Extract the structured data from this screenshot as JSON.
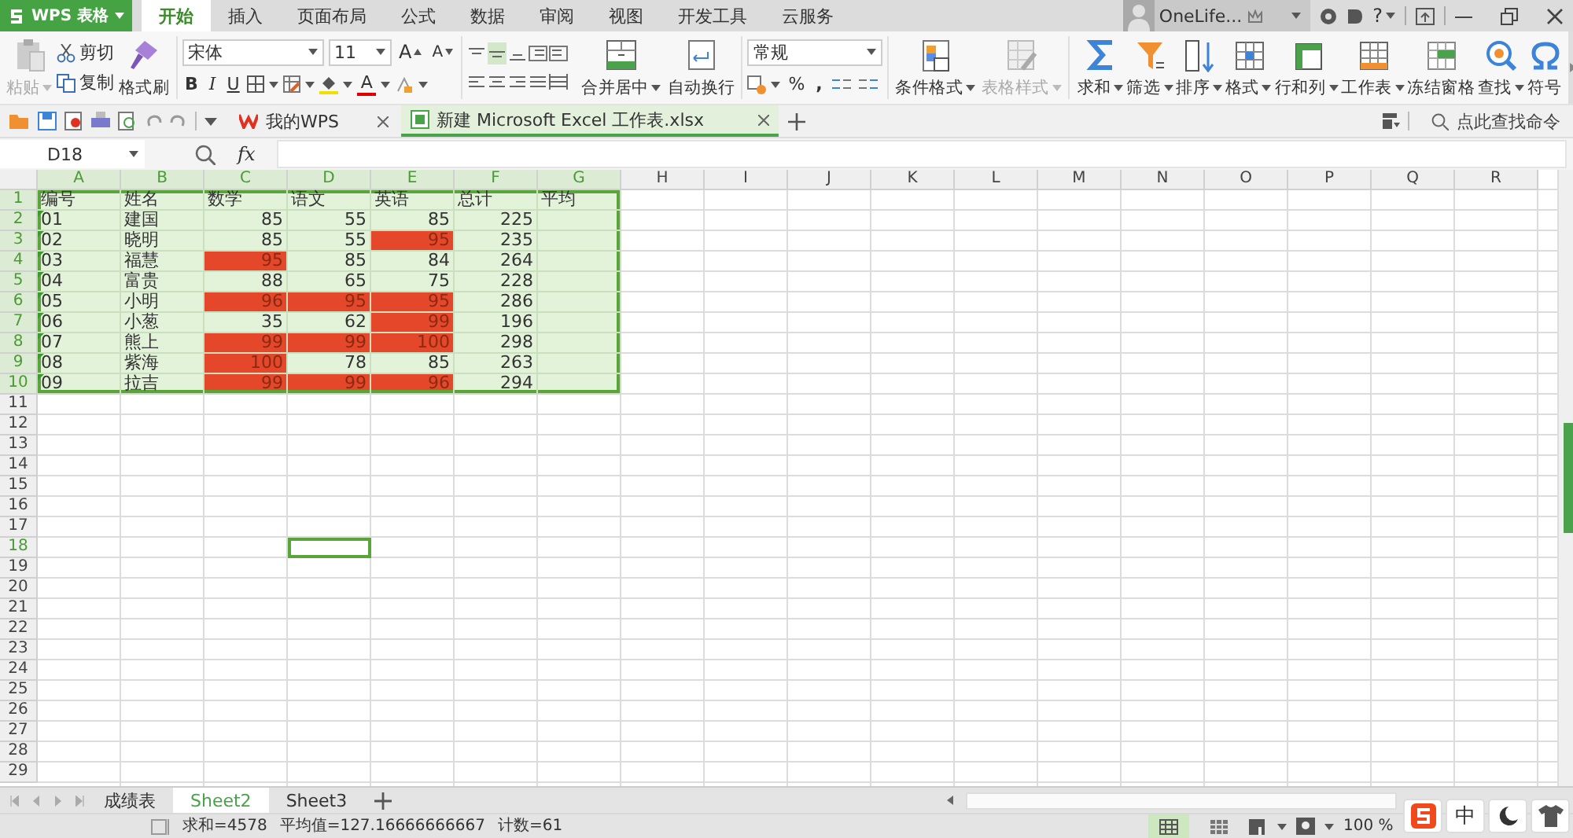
{
  "app_menu": {
    "label": "WPS 表格"
  },
  "ribbon_tabs": [
    {
      "label": "开始",
      "selected": true
    },
    {
      "label": "插入",
      "selected": false
    },
    {
      "label": "页面布局",
      "selected": false
    },
    {
      "label": "公式",
      "selected": false
    },
    {
      "label": "数据",
      "selected": false
    },
    {
      "label": "审阅",
      "selected": false
    },
    {
      "label": "视图",
      "selected": false
    },
    {
      "label": "开发工具",
      "selected": false
    },
    {
      "label": "云服务",
      "selected": false
    }
  ],
  "account": {
    "name": "OneLife...",
    "help": "?"
  },
  "ribbon": {
    "paste": {
      "label": "粘贴",
      "disabled": true
    },
    "cut": "剪切",
    "copy": "复制",
    "format_painter": "格式刷",
    "font_name": "宋体",
    "font_size": "11",
    "grow_font": "A",
    "shrink_font": "A",
    "bold": "B",
    "italic": "I",
    "underline": "U",
    "font_color": "A",
    "align_buttons": [
      {
        "label": "合并居中",
        "caret": true
      },
      {
        "label": "自动换行",
        "caret": false
      }
    ],
    "number_format": "常规",
    "percent": "%",
    "comma": ",",
    "tools": [
      {
        "label": "条件格式",
        "caret": true,
        "disabled": false
      },
      {
        "label": "表格样式",
        "caret": true,
        "disabled": true
      },
      {
        "label": "求和",
        "caret": true,
        "disabled": false
      },
      {
        "label": "筛选",
        "caret": true,
        "disabled": false
      },
      {
        "label": "排序",
        "caret": true,
        "disabled": false
      },
      {
        "label": "格式",
        "caret": true,
        "disabled": false
      },
      {
        "label": "行和列",
        "caret": true,
        "disabled": false
      },
      {
        "label": "工作表",
        "caret": true,
        "disabled": false
      },
      {
        "label": "冻结窗格",
        "caret": false,
        "disabled": false
      },
      {
        "label": "查找",
        "caret": true,
        "disabled": false
      },
      {
        "label": "符号",
        "caret": false,
        "disabled": false
      }
    ],
    "command_search": {
      "placeholder": "点此查找命令"
    }
  },
  "doc_tabs": [
    {
      "label": "我的WPS",
      "selected": false
    },
    {
      "label": "新建 Microsoft Excel 工作表.xlsx",
      "selected": true
    }
  ],
  "formula_bar": {
    "name_box": "D18",
    "fx": "fx"
  },
  "sheet": {
    "columns": [
      {
        "label": "A",
        "selected": true,
        "cursor": false
      },
      {
        "label": "B",
        "selected": true,
        "cursor": false
      },
      {
        "label": "C",
        "selected": true,
        "cursor": false
      },
      {
        "label": "D",
        "selected": true,
        "cursor": true
      },
      {
        "label": "E",
        "selected": true,
        "cursor": false
      },
      {
        "label": "F",
        "selected": true,
        "cursor": false
      },
      {
        "label": "G",
        "selected": true,
        "cursor": false
      },
      {
        "label": "H",
        "selected": false,
        "cursor": false
      },
      {
        "label": "I",
        "selected": false,
        "cursor": false
      },
      {
        "label": "J",
        "selected": false,
        "cursor": false
      },
      {
        "label": "K",
        "selected": false,
        "cursor": false
      },
      {
        "label": "L",
        "selected": false,
        "cursor": false
      },
      {
        "label": "M",
        "selected": false,
        "cursor": false
      },
      {
        "label": "N",
        "selected": false,
        "cursor": false
      },
      {
        "label": "O",
        "selected": false,
        "cursor": false
      },
      {
        "label": "P",
        "selected": false,
        "cursor": false
      },
      {
        "label": "Q",
        "selected": false,
        "cursor": false
      },
      {
        "label": "R",
        "selected": false,
        "cursor": false
      }
    ],
    "rows": [
      {
        "header": "1",
        "selected": true,
        "cursor": false,
        "flagged": false,
        "cells": [
          {
            "text": "编号",
            "kind": "text",
            "highlighted": false
          },
          {
            "text": "姓名",
            "kind": "text",
            "highlighted": false
          },
          {
            "text": "数学",
            "kind": "text",
            "highlighted": false
          },
          {
            "text": "语文",
            "kind": "text",
            "highlighted": false
          },
          {
            "text": "英语",
            "kind": "text",
            "highlighted": false
          },
          {
            "text": "总计",
            "kind": "text",
            "highlighted": false
          },
          {
            "text": "平均",
            "kind": "text",
            "highlighted": false
          }
        ]
      },
      {
        "header": "2",
        "selected": true,
        "cursor": false,
        "flagged": true,
        "cells": [
          {
            "text": "01",
            "kind": "text",
            "highlighted": false
          },
          {
            "text": "建国",
            "kind": "text",
            "highlighted": false
          },
          {
            "text": "85",
            "kind": "number",
            "highlighted": false
          },
          {
            "text": "55",
            "kind": "number",
            "highlighted": false
          },
          {
            "text": "85",
            "kind": "number",
            "highlighted": false
          },
          {
            "text": "225",
            "kind": "number",
            "highlighted": false
          }
        ]
      },
      {
        "header": "3",
        "selected": true,
        "cursor": false,
        "flagged": true,
        "cells": [
          {
            "text": "02",
            "kind": "text",
            "highlighted": false
          },
          {
            "text": "晓明",
            "kind": "text",
            "highlighted": false
          },
          {
            "text": "85",
            "kind": "number",
            "highlighted": false
          },
          {
            "text": "55",
            "kind": "number",
            "highlighted": false
          },
          {
            "text": "95",
            "kind": "number",
            "highlighted": true
          },
          {
            "text": "235",
            "kind": "number",
            "highlighted": false
          }
        ]
      },
      {
        "header": "4",
        "selected": true,
        "cursor": false,
        "flagged": true,
        "cells": [
          {
            "text": "03",
            "kind": "text",
            "highlighted": false
          },
          {
            "text": "福慧",
            "kind": "text",
            "highlighted": false
          },
          {
            "text": "95",
            "kind": "number",
            "highlighted": true
          },
          {
            "text": "85",
            "kind": "number",
            "highlighted": false
          },
          {
            "text": "84",
            "kind": "number",
            "highlighted": false
          },
          {
            "text": "264",
            "kind": "number",
            "highlighted": false
          }
        ]
      },
      {
        "header": "5",
        "selected": true,
        "cursor": false,
        "flagged": true,
        "cells": [
          {
            "text": "04",
            "kind": "text",
            "highlighted": false
          },
          {
            "text": "富贵",
            "kind": "text",
            "highlighted": false
          },
          {
            "text": "88",
            "kind": "number",
            "highlighted": false
          },
          {
            "text": "65",
            "kind": "number",
            "highlighted": false
          },
          {
            "text": "75",
            "kind": "number",
            "highlighted": false
          },
          {
            "text": "228",
            "kind": "number",
            "highlighted": false
          }
        ]
      },
      {
        "header": "6",
        "selected": true,
        "cursor": false,
        "flagged": true,
        "cells": [
          {
            "text": "05",
            "kind": "text",
            "highlighted": false
          },
          {
            "text": "小明",
            "kind": "text",
            "highlighted": false
          },
          {
            "text": "96",
            "kind": "number",
            "highlighted": true
          },
          {
            "text": "95",
            "kind": "number",
            "highlighted": true
          },
          {
            "text": "95",
            "kind": "number",
            "highlighted": true
          },
          {
            "text": "286",
            "kind": "number",
            "highlighted": false
          }
        ]
      },
      {
        "header": "7",
        "selected": true,
        "cursor": false,
        "flagged": true,
        "cells": [
          {
            "text": "06",
            "kind": "text",
            "highlighted": false
          },
          {
            "text": "小葱",
            "kind": "text",
            "highlighted": false
          },
          {
            "text": "35",
            "kind": "number",
            "highlighted": false
          },
          {
            "text": "62",
            "kind": "number",
            "highlighted": false
          },
          {
            "text": "99",
            "kind": "number",
            "highlighted": true
          },
          {
            "text": "196",
            "kind": "number",
            "highlighted": false
          }
        ]
      },
      {
        "header": "8",
        "selected": true,
        "cursor": false,
        "flagged": true,
        "cells": [
          {
            "text": "07",
            "kind": "text",
            "highlighted": false
          },
          {
            "text": "熊上",
            "kind": "text",
            "highlighted": false
          },
          {
            "text": "99",
            "kind": "number",
            "highlighted": true
          },
          {
            "text": "99",
            "kind": "number",
            "highlighted": true
          },
          {
            "text": "100",
            "kind": "number",
            "highlighted": true
          },
          {
            "text": "298",
            "kind": "number",
            "highlighted": false
          }
        ]
      },
      {
        "header": "9",
        "selected": true,
        "cursor": false,
        "flagged": true,
        "cells": [
          {
            "text": "08",
            "kind": "text",
            "highlighted": false
          },
          {
            "text": "紫海",
            "kind": "text",
            "highlighted": false
          },
          {
            "text": "100",
            "kind": "number",
            "highlighted": true
          },
          {
            "text": "78",
            "kind": "number",
            "highlighted": false
          },
          {
            "text": "85",
            "kind": "number",
            "highlighted": false
          },
          {
            "text": "263",
            "kind": "number",
            "highlighted": false
          }
        ]
      },
      {
        "header": "10",
        "selected": true,
        "cursor": false,
        "flagged": true,
        "cells": [
          {
            "text": "09",
            "kind": "text",
            "highlighted": false
          },
          {
            "text": "拉吉",
            "kind": "text",
            "highlighted": false
          },
          {
            "text": "99",
            "kind": "number",
            "highlighted": true
          },
          {
            "text": "99",
            "kind": "number",
            "highlighted": true
          },
          {
            "text": "96",
            "kind": "number",
            "highlighted": true
          },
          {
            "text": "294",
            "kind": "number",
            "highlighted": false
          }
        ]
      },
      {
        "header": "11",
        "selected": false,
        "cursor": false,
        "flagged": false
      },
      {
        "header": "12",
        "selected": false,
        "cursor": false,
        "flagged": false
      },
      {
        "header": "13",
        "selected": false,
        "cursor": false,
        "flagged": false
      },
      {
        "header": "14",
        "selected": false,
        "cursor": false,
        "flagged": false
      },
      {
        "header": "15",
        "selected": false,
        "cursor": false,
        "flagged": false
      },
      {
        "header": "16",
        "selected": false,
        "cursor": false,
        "flagged": false
      },
      {
        "header": "17",
        "selected": false,
        "cursor": false,
        "flagged": false
      },
      {
        "header": "18",
        "selected": false,
        "cursor": true,
        "flagged": false
      },
      {
        "header": "19",
        "selected": false,
        "cursor": false,
        "flagged": false
      },
      {
        "header": "20",
        "selected": false,
        "cursor": false,
        "flagged": false
      },
      {
        "header": "21",
        "selected": false,
        "cursor": false,
        "flagged": false
      },
      {
        "header": "22",
        "selected": false,
        "cursor": false,
        "flagged": false
      },
      {
        "header": "23",
        "selected": false,
        "cursor": false,
        "flagged": false
      },
      {
        "header": "24",
        "selected": false,
        "cursor": false,
        "flagged": false
      },
      {
        "header": "25",
        "selected": false,
        "cursor": false,
        "flagged": false
      },
      {
        "header": "26",
        "selected": false,
        "cursor": false,
        "flagged": false
      },
      {
        "header": "27",
        "selected": false,
        "cursor": false,
        "flagged": false
      },
      {
        "header": "28",
        "selected": false,
        "cursor": false,
        "flagged": false
      },
      {
        "header": "29",
        "selected": false,
        "cursor": false,
        "flagged": false
      }
    ]
  },
  "sheet_tabs": [
    {
      "label": "成绩表",
      "selected": false
    },
    {
      "label": "Sheet2",
      "selected": true
    },
    {
      "label": "Sheet3",
      "selected": false
    }
  ],
  "status_bar": {
    "items": [
      "求和=4578",
      "平均值=127.16666666667",
      "计数=61"
    ],
    "view_buttons": [
      {
        "selected": true
      },
      {
        "selected": false
      }
    ],
    "zoom": "100 %"
  },
  "ime_toolbar": {
    "mode": "中"
  }
}
